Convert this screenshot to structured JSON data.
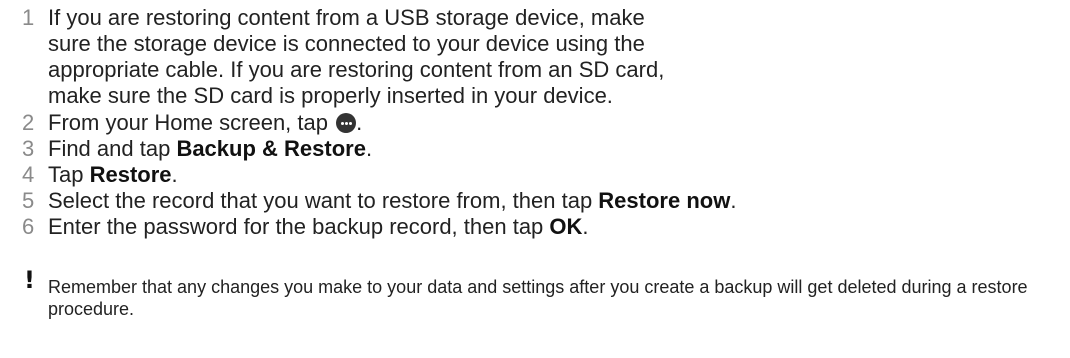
{
  "steps": [
    {
      "number": "1",
      "text": "If you are restoring content from a USB storage device, make sure the storage device is connected to your device using the appropriate cable. If you are restoring content from an SD card, make sure the SD card is properly inserted in your device."
    },
    {
      "number": "2",
      "text_before": "From your Home screen, tap",
      "icon": "apps-icon",
      "text_after": "."
    },
    {
      "number": "3",
      "text_before": "Find and tap ",
      "bold": "Backup & Restore",
      "text_after": "."
    },
    {
      "number": "4",
      "text_before": "Tap ",
      "bold": "Restore",
      "text_after": "."
    },
    {
      "number": "5",
      "text_before": "Select the record that you want to restore from, then tap ",
      "bold": "Restore now",
      "text_after": "."
    },
    {
      "number": "6",
      "text_before": "Enter the password for the backup record, then tap ",
      "bold": "OK",
      "text_after": "."
    }
  ],
  "note": {
    "icon": "exclamation-icon",
    "symbol": "!",
    "text": "Remember that any changes you make to your data and settings after you create a backup will get deleted during a restore procedure."
  }
}
